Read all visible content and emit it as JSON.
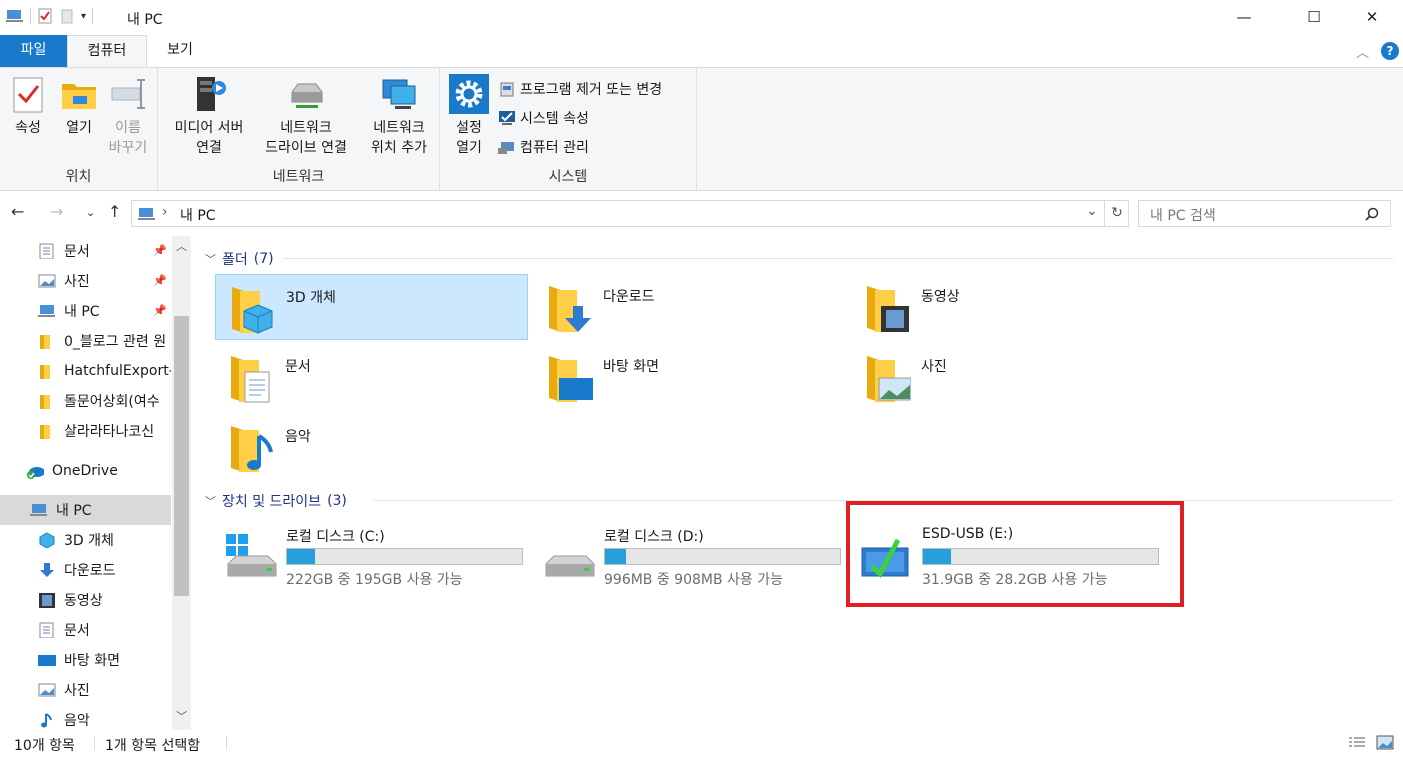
{
  "window": {
    "title": "내 PC",
    "minimize": "—",
    "maximize": "☐",
    "close": "✕"
  },
  "tabs": {
    "file": "파일",
    "computer": "컴퓨터",
    "view": "보기"
  },
  "ribbon": {
    "location": {
      "label": "위치",
      "properties": "속성",
      "open": "열기",
      "rename_1": "이름",
      "rename_2": "바꾸기"
    },
    "network": {
      "label": "네트워크",
      "media_1": "미디어 서버",
      "media_2": "연결",
      "map_1": "네트워크",
      "map_2": "드라이브 연결",
      "add_1": "네트워크",
      "add_2": "위치 추가"
    },
    "system": {
      "label": "시스템",
      "settings_1": "설정",
      "settings_2": "열기",
      "uninstall": "프로그램 제거 또는 변경",
      "sysprops": "시스템 속성",
      "manage": "컴퓨터 관리"
    }
  },
  "address": {
    "crumb": "내 PC",
    "search_placeholder": "내 PC 검색"
  },
  "sidebar": {
    "items": [
      {
        "label": "문서",
        "pinned": true
      },
      {
        "label": "사진",
        "pinned": true
      },
      {
        "label": "내 PC",
        "pinned": true
      },
      {
        "label": "0_블로그 관련 원"
      },
      {
        "label": "HatchfulExport-A"
      },
      {
        "label": "돌문어상회(여수"
      },
      {
        "label": "살라라타나코신"
      },
      {
        "label": "OneDrive"
      },
      {
        "label": "내 PC",
        "selected": true
      },
      {
        "label": "3D 개체"
      },
      {
        "label": "다운로드"
      },
      {
        "label": "동영상"
      },
      {
        "label": "문서"
      },
      {
        "label": "바탕 화면"
      },
      {
        "label": "사진"
      },
      {
        "label": "음악"
      }
    ]
  },
  "folders_section": {
    "title": "폴더",
    "count": "(7)"
  },
  "folders": [
    "3D 개체",
    "다운로드",
    "동영상",
    "문서",
    "바탕 화면",
    "사진",
    "음악"
  ],
  "drives_section": {
    "title": "장치 및 드라이브",
    "count": "(3)"
  },
  "drives": [
    {
      "name": "로컬 디스크 (C:)",
      "free": "222GB 중 195GB 사용 가능",
      "used_fraction": 0.12
    },
    {
      "name": "로컬 디스크 (D:)",
      "free": "996MB 중 908MB 사용 가능",
      "used_fraction": 0.09
    },
    {
      "name": "ESD-USB (E:)",
      "free": "31.9GB 중 28.2GB 사용 가능",
      "used_fraction": 0.12
    }
  ],
  "status": {
    "items": "10개 항목",
    "selected": "1개 항목 선택함"
  },
  "colors": {
    "accent": "#1979ca",
    "highlight": "#e02020",
    "bar": "#26a0da",
    "selection": "#cce8ff"
  }
}
